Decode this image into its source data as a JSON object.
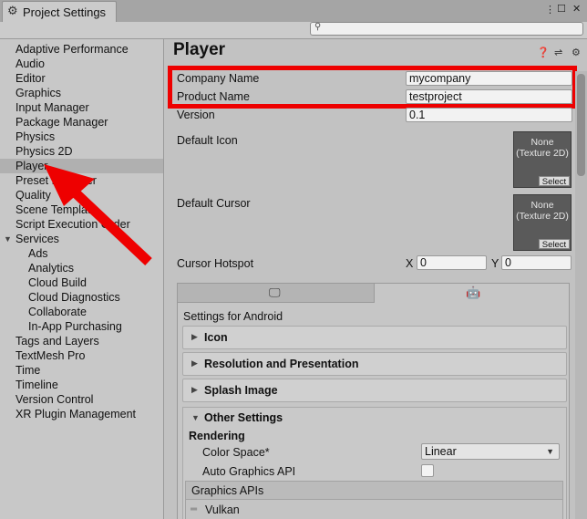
{
  "window": {
    "tab_title": "Project Settings",
    "menu_icon": "more-icon",
    "maximize_icon": "maximize-icon",
    "close_icon": "close-icon"
  },
  "search": {
    "placeholder": ""
  },
  "sidebar": {
    "items": [
      {
        "label": "Adaptive Performance"
      },
      {
        "label": "Audio"
      },
      {
        "label": "Editor"
      },
      {
        "label": "Graphics"
      },
      {
        "label": "Input Manager"
      },
      {
        "label": "Package Manager"
      },
      {
        "label": "Physics"
      },
      {
        "label": "Physics 2D"
      },
      {
        "label": "Player",
        "selected": true
      },
      {
        "label": "Preset Manager"
      },
      {
        "label": "Quality"
      },
      {
        "label": "Scene Template"
      },
      {
        "label": "Script Execution Order"
      },
      {
        "label": "Services",
        "expanded": true
      },
      {
        "label": "Ads"
      },
      {
        "label": "Analytics"
      },
      {
        "label": "Cloud Build"
      },
      {
        "label": "Cloud Diagnostics"
      },
      {
        "label": "Collaborate"
      },
      {
        "label": "In-App Purchasing"
      },
      {
        "label": "Tags and Layers"
      },
      {
        "label": "TextMesh Pro"
      },
      {
        "label": "Time"
      },
      {
        "label": "Timeline"
      },
      {
        "label": "Version Control"
      },
      {
        "label": "XR Plugin Management"
      }
    ]
  },
  "main": {
    "title": "Player",
    "company_label": "Company Name",
    "company_value": "mycompany",
    "product_label": "Product Name",
    "product_value": "testproject",
    "version_label": "Version",
    "version_value": "0.1",
    "default_icon_label": "Default Icon",
    "default_cursor_label": "Default Cursor",
    "texture_none": "None",
    "texture_type": "(Texture 2D)",
    "select_label": "Select",
    "hotspot_label": "Cursor Hotspot",
    "hotspot_x_label": "X",
    "hotspot_x_value": "0",
    "hotspot_y_label": "Y",
    "hotspot_y_value": "0",
    "settings_for": "Settings for Android",
    "sections": [
      {
        "title": "Icon"
      },
      {
        "title": "Resolution and Presentation"
      },
      {
        "title": "Splash Image"
      }
    ],
    "other_settings_title": "Other Settings",
    "rendering_label": "Rendering",
    "color_space_label": "Color Space*",
    "color_space_value": "Linear",
    "auto_graphics_label": "Auto Graphics API",
    "auto_graphics_checked": false,
    "graphics_apis_label": "Graphics APIs",
    "graphics_apis": [
      "Vulkan"
    ]
  },
  "annotations": {
    "highlight_color": "#ee0000",
    "arrow_color": "#ee0000"
  }
}
